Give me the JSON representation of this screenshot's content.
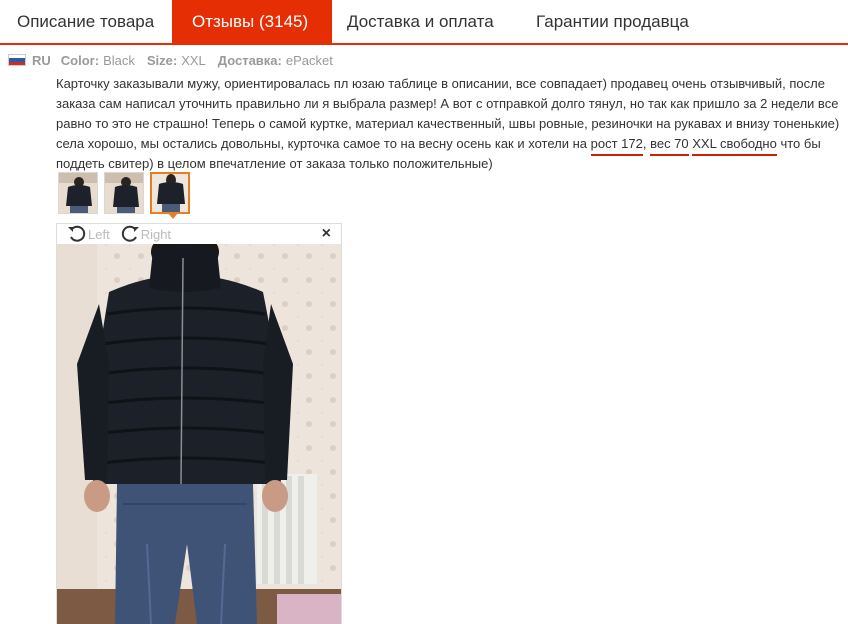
{
  "tabs": [
    {
      "label": "Описание товара",
      "active": false
    },
    {
      "label": "Отзывы (3145)",
      "active": true
    },
    {
      "label": "Доставка и оплата",
      "active": false
    },
    {
      "label": "Гарантии продавца",
      "active": false
    }
  ],
  "review": {
    "country": "RU",
    "color_label": "Color:",
    "color_value": "Black",
    "size_label": "Size:",
    "size_value": "XXL",
    "shipping_label": "Доставка:",
    "shipping_value": "ePacket",
    "text_part1": "Карточку заказывали мужу, ориентировалась пл юзаю таблице в описании, все совпадает) продавец очень отзывчивый, после заказа сам написал уточнить правильно ли я выбрала размер! А вот с отправкой долго тянул, но так как пришло за 2 недели все равно то это не страшно! Теперь о самой куртке, материал качественный, швы ровные, резиночки на рукавах и внизу тоненькие) села хорошо, мы остались довольны, курточка самое то на весну осень как и хотели на ",
    "highlight1": "рост 172",
    "text_part2": ", ",
    "highlight2": "вес 70",
    "text_part3": " ",
    "highlight3": "XXL свободно",
    "text_part4": " что бы поддеть свитер) в целом впечатление от заказа только положительные)"
  },
  "viewer": {
    "rotate_left_label": "Left",
    "rotate_right_label": "Right",
    "close_symbol": "×"
  },
  "colors": {
    "accent": "#e62e04",
    "thumb_active": "#e67e22"
  }
}
